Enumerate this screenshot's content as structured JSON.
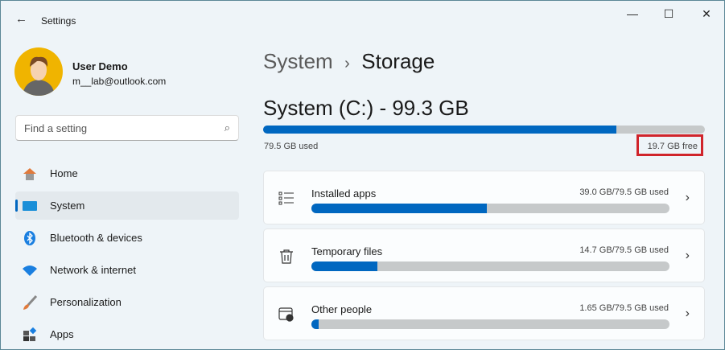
{
  "window": {
    "title": "Settings",
    "minimize": "—",
    "maximize": "☐",
    "close": "✕"
  },
  "user": {
    "name": "User Demo",
    "email": "m__lab@outlook.com"
  },
  "search": {
    "placeholder": "Find a setting"
  },
  "nav": [
    {
      "label": "Home"
    },
    {
      "label": "System"
    },
    {
      "label": "Bluetooth & devices"
    },
    {
      "label": "Network & internet"
    },
    {
      "label": "Personalization"
    },
    {
      "label": "Apps"
    }
  ],
  "breadcrumb": {
    "parent": "System",
    "sep": "›",
    "current": "Storage"
  },
  "drive": {
    "title": "System (C:) - 99.3 GB",
    "used": "79.5 GB used",
    "free": "19.7 GB free",
    "used_fraction": 0.8
  },
  "categories": [
    {
      "label": "Installed apps",
      "usage": "39.0 GB/79.5 GB used",
      "fraction": 0.49
    },
    {
      "label": "Temporary files",
      "usage": "14.7 GB/79.5 GB used",
      "fraction": 0.185
    },
    {
      "label": "Other people",
      "usage": "1.65 GB/79.5 GB used",
      "fraction": 0.02
    }
  ],
  "colors": {
    "accent": "#0067c0",
    "highlight": "#d0242b"
  }
}
